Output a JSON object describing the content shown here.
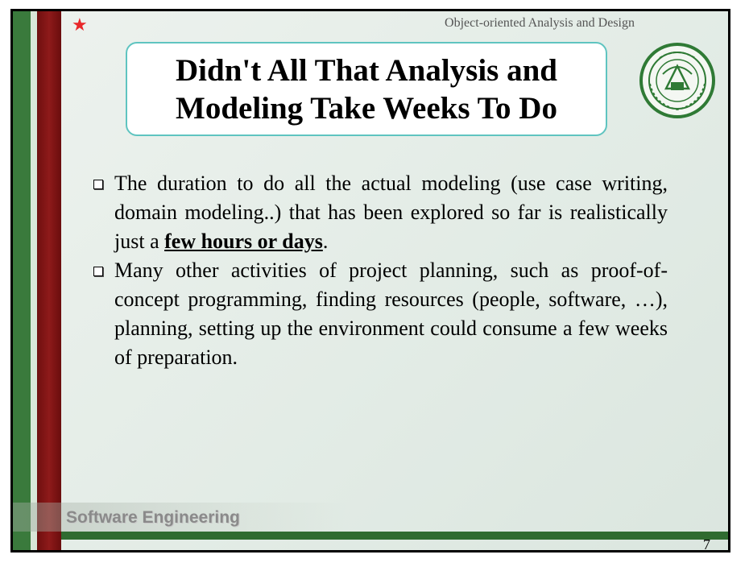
{
  "header": {
    "course_title": "Object-oriented Analysis and Design"
  },
  "title": {
    "line1": "Didn't All That Analysis and",
    "line2": "Modeling Take Weeks To Do"
  },
  "bullets": [
    {
      "before": "The duration to do all the actual modeling (use case writing, domain modeling..) that has been explored so far is realistically just a ",
      "emphasis": "few hours or days",
      "after": "."
    },
    {
      "text": "Many other activities of project planning, such as proof-of-concept programming, finding resources (people, software, …), planning, setting up the environment could consume a few weeks of preparation."
    }
  ],
  "footer": {
    "label": "Software Engineering",
    "page_number": "7"
  },
  "colors": {
    "accent_red": "#8e1a1a",
    "accent_green": "#3a7a3c",
    "title_border": "#5fc4c0",
    "star": "#e8282a"
  },
  "icons": {
    "star": "star-icon",
    "logo": "university-seal-logo",
    "bullet": "square-bullet-icon"
  }
}
